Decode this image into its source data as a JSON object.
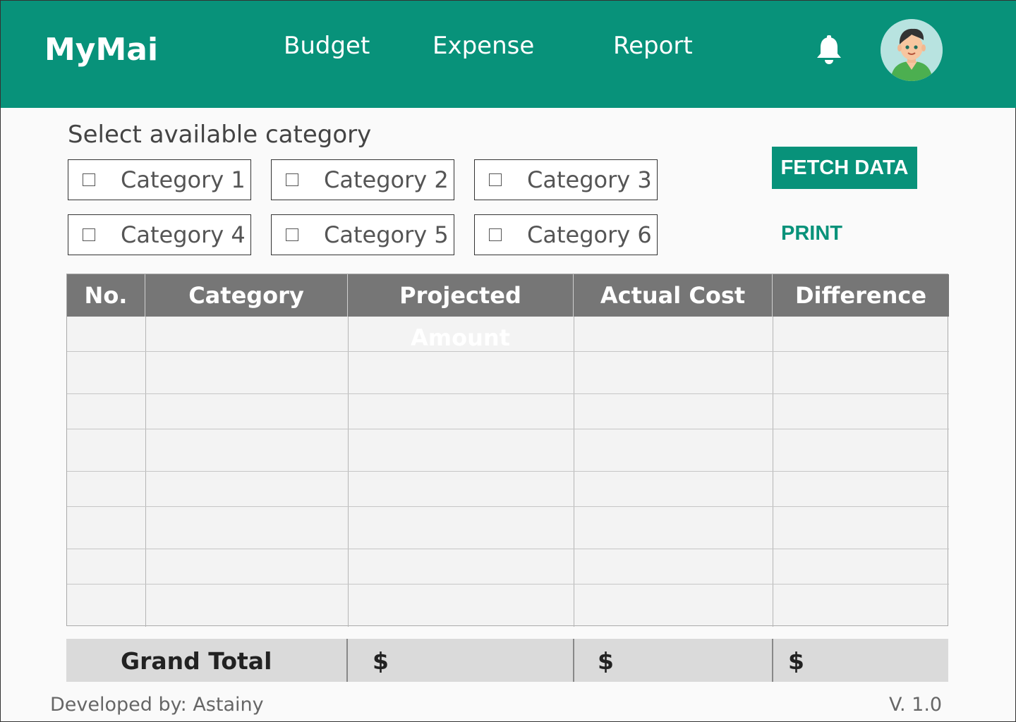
{
  "app": {
    "logo": "MyMai"
  },
  "nav": {
    "budget": "Budget",
    "expense": "Expense",
    "report": "Report"
  },
  "icons": {
    "bell": "bell-icon",
    "avatar": "user-avatar"
  },
  "colors": {
    "brand": "#08927a",
    "table_header": "#767676",
    "grand_total_bg": "#dadada"
  },
  "categories": {
    "title": "Select available category",
    "items": [
      {
        "label": "Category 1",
        "checked": false
      },
      {
        "label": "Category 2",
        "checked": false
      },
      {
        "label": "Category 3",
        "checked": false
      },
      {
        "label": "Category 4",
        "checked": false
      },
      {
        "label": "Category 5",
        "checked": false
      },
      {
        "label": "Category 6",
        "checked": false
      }
    ]
  },
  "actions": {
    "fetch": "FETCH DATA",
    "print": "PRINT"
  },
  "table": {
    "headers": [
      "No.",
      "Category",
      "Projected Amount",
      "Actual Cost",
      "Difference"
    ],
    "rows": [
      [
        "",
        "",
        "",
        "",
        ""
      ],
      [
        "",
        "",
        "",
        "",
        ""
      ],
      [
        "",
        "",
        "",
        "",
        ""
      ],
      [
        "",
        "",
        "",
        "",
        ""
      ],
      [
        "",
        "",
        "",
        "",
        ""
      ],
      [
        "",
        "",
        "",
        "",
        ""
      ],
      [
        "",
        "",
        "",
        "",
        ""
      ],
      [
        "",
        "",
        "",
        "",
        ""
      ]
    ]
  },
  "grand_total": {
    "label": "Grand Total",
    "projected": "$",
    "actual": "$",
    "difference": "$"
  },
  "footer": {
    "developer": "Developed by: Astainy",
    "version": "V. 1.0"
  }
}
